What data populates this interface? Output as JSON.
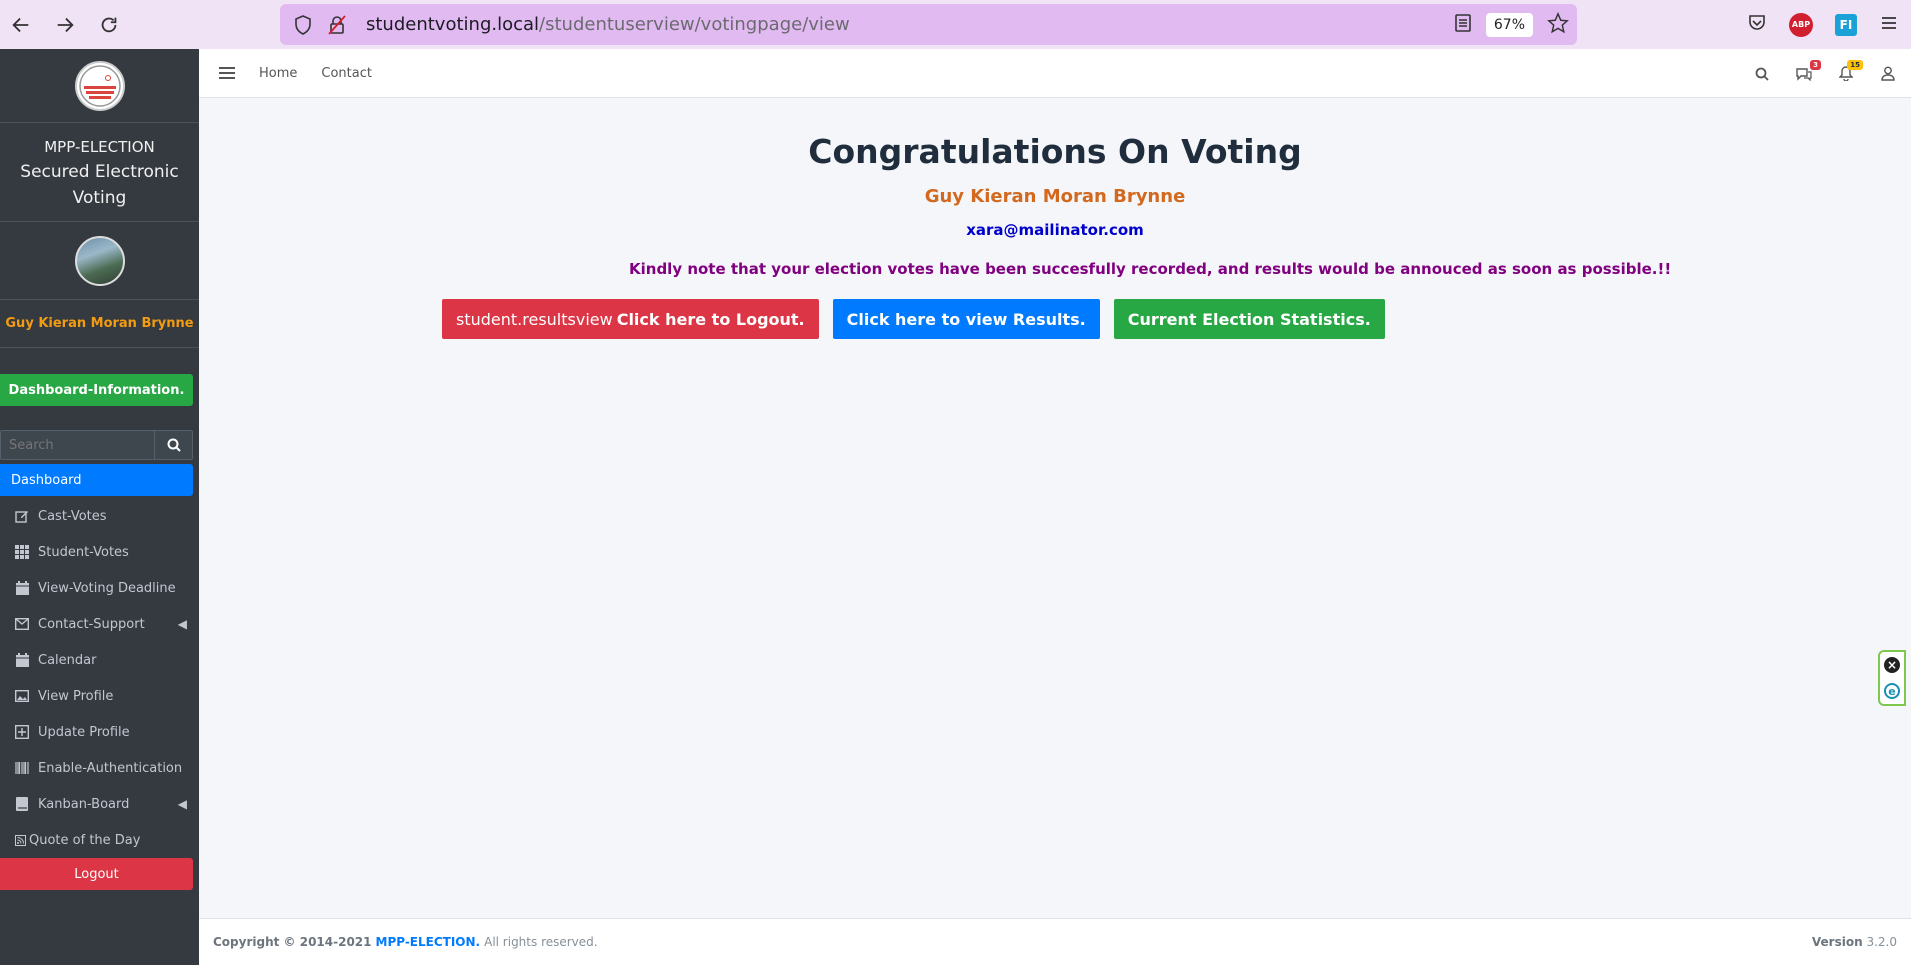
{
  "browser": {
    "url_host": "studentvoting.local",
    "url_path": "/studentuserview/votingpage/view",
    "zoom": "67%"
  },
  "sidebar": {
    "brand_line1": "MPP-ELECTION",
    "brand_line2": "Secured Electronic Voting",
    "user_name": "Guy Kieran Moran Brynne",
    "dashboard_info": "Dashboard-Information.",
    "search_placeholder": "Search",
    "items": [
      {
        "label": "Dashboard",
        "icon": "none"
      },
      {
        "label": "Cast-Votes",
        "icon": "edit-icon"
      },
      {
        "label": "Student-Votes",
        "icon": "grid-icon"
      },
      {
        "label": "View-Voting Deadline",
        "icon": "calendar-icon"
      },
      {
        "label": "Contact-Support",
        "icon": "envelope-icon"
      },
      {
        "label": "Calendar",
        "icon": "calendar-icon"
      },
      {
        "label": "View Profile",
        "icon": "image-icon"
      },
      {
        "label": "Update Profile",
        "icon": "plus-square-icon"
      },
      {
        "label": "Enable-Authentication",
        "icon": "barcode-icon"
      },
      {
        "label": "Kanban-Board",
        "icon": "book-icon"
      },
      {
        "label": "Quote of the Day",
        "icon": "rss-icon"
      }
    ],
    "logout": "Logout"
  },
  "topbar": {
    "home": "Home",
    "contact": "Contact",
    "messages_count": "3",
    "notifications_count": "15"
  },
  "main": {
    "title": "Congratulations On Voting",
    "name": "Guy Kieran Moran Brynne",
    "email": "xara@mailinator.com",
    "note": "Kindly note that your election votes have been succesfully recorded, and results would be annouced as soon as possible.!!",
    "logout_prefix": "student.resultsview",
    "logout_label": "Click here to Logout.",
    "results_label": "Click here to view Results.",
    "stats_label": "Current Election Statistics."
  },
  "footer": {
    "copyright": "Copyright © 2014-2021",
    "brand": "MPP-ELECTION.",
    "rights": "All rights reserved.",
    "version_label": "Version",
    "version": "3.2.0"
  },
  "colors": {
    "sidebar_bg": "#343a40",
    "accent_blue": "#007bff",
    "success_green": "#28a745",
    "danger_red": "#dc3545",
    "name_orange": "#d2691e",
    "note_purple": "#800080"
  }
}
